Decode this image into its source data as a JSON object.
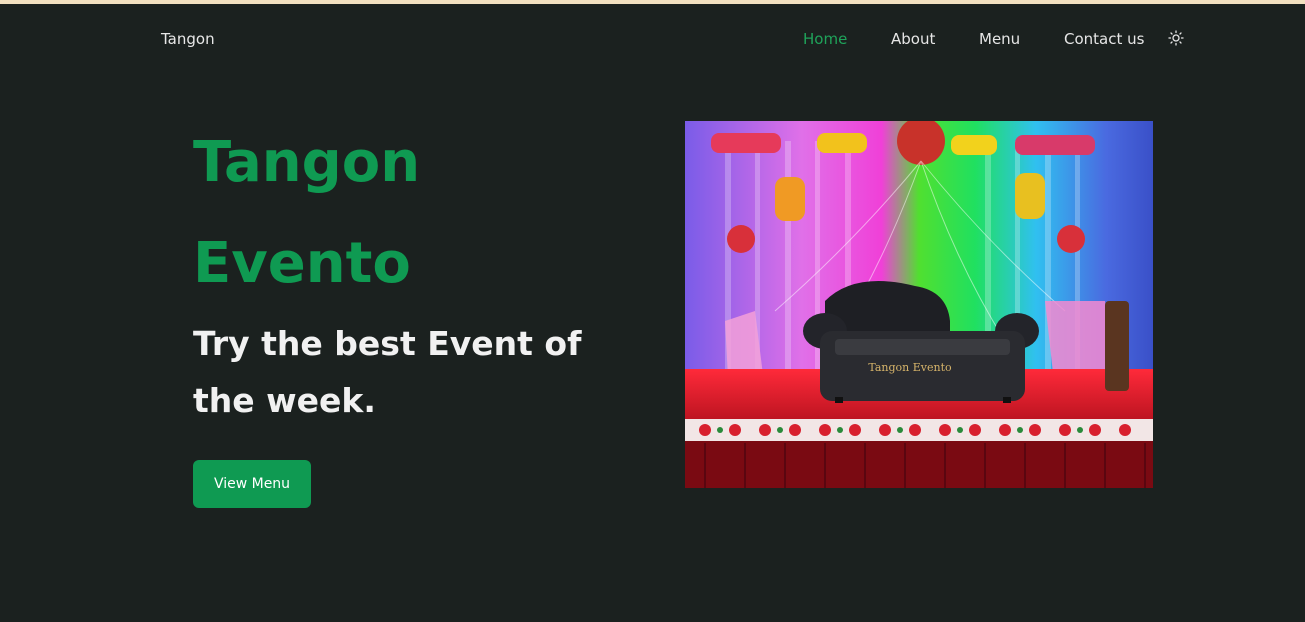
{
  "brand": "Tangon",
  "nav": {
    "items": [
      {
        "label": "Home",
        "active": true
      },
      {
        "label": "About",
        "active": false
      },
      {
        "label": "Menu",
        "active": false
      },
      {
        "label": "Contact us",
        "active": false
      }
    ],
    "theme_icon": "sun-icon"
  },
  "hero": {
    "title_line1": "Tangon",
    "title_line2": "Evento",
    "subtitle_line1": "Try the best Event of",
    "subtitle_line2": "the week.",
    "cta_label": "View Menu",
    "image_logo_text": "Tangon Evento"
  },
  "colors": {
    "background": "#1b211f",
    "accent": "#0f9a52",
    "top_strip": "#f3e0c0",
    "nav_text": "#e6e6e6"
  }
}
